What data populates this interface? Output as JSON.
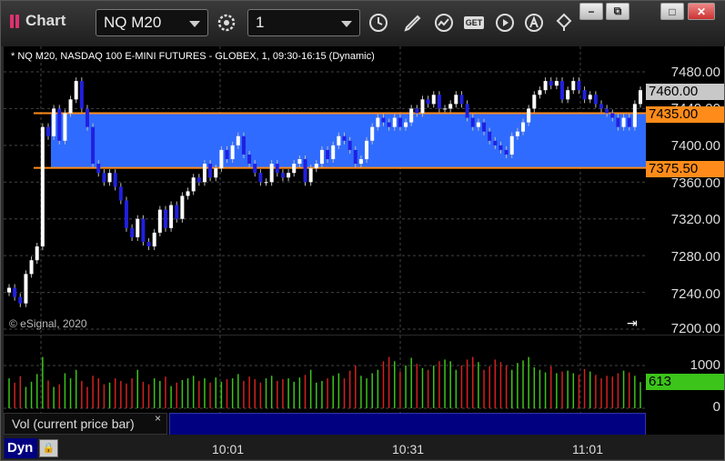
{
  "window": {
    "title": "Chart",
    "symbol": "NQ M20",
    "interval": "1",
    "controls": [
      "−",
      "⧉",
      "□",
      "✕"
    ]
  },
  "toolbar": [
    {
      "name": "settings-icon"
    },
    {
      "name": "clock-icon"
    },
    {
      "name": "pencil-icon"
    },
    {
      "name": "study-icon"
    },
    {
      "name": "get-icon",
      "label": "GET"
    },
    {
      "name": "play-icon"
    },
    {
      "name": "alert-icon"
    },
    {
      "name": "link-icon"
    }
  ],
  "chart": {
    "header": "* NQ M20, NASDAQ 100 E-MINI FUTURES - GLOBEX, 1, 09:30-16:15 (Dynamic)",
    "copyright": "© eSignal, 2020",
    "price_ticks": [
      "7480.00",
      "7440.00",
      "7400.00",
      "7360.00",
      "7320.00",
      "7280.00",
      "7240.00",
      "7200.00"
    ],
    "flags": {
      "last": "7460.00",
      "upper": "7435.00",
      "lower": "7375.50"
    },
    "zone_color": "#2f6bff",
    "line_color": "#ff8c1a"
  },
  "volume": {
    "study_label": "Vol (current price bar)",
    "close_glyph": "×",
    "ticks": [
      "1000",
      "0"
    ],
    "flag": "613"
  },
  "timebar": {
    "mode": "Dyn",
    "ticks": [
      "10:01",
      "10:31",
      "11:01"
    ]
  },
  "chart_data": {
    "type": "candlestick",
    "title": "* NQ M20, NASDAQ 100 E-MINI FUTURES - GLOBEX, 1, 09:30-16:15 (Dynamic)",
    "ylim": [
      7200,
      7500
    ],
    "zone": [
      7375.5,
      7435.0
    ],
    "last": 7460.0,
    "volume_last": 613,
    "volume_ylim": [
      0,
      1500
    ],
    "closes": [
      7245,
      7235,
      7228,
      7260,
      7275,
      7290,
      7420,
      7410,
      7440,
      7405,
      7435,
      7450,
      7470,
      7440,
      7420,
      7380,
      7370,
      7360,
      7370,
      7355,
      7340,
      7310,
      7300,
      7320,
      7295,
      7290,
      7305,
      7330,
      7310,
      7335,
      7320,
      7345,
      7350,
      7365,
      7360,
      7380,
      7365,
      7375,
      7395,
      7385,
      7400,
      7410,
      7390,
      7380,
      7370,
      7360,
      7360,
      7380,
      7370,
      7365,
      7370,
      7380,
      7385,
      7360,
      7375,
      7380,
      7395,
      7385,
      7400,
      7410,
      7405,
      7395,
      7380,
      7385,
      7405,
      7420,
      7430,
      7425,
      7420,
      7430,
      7420,
      7425,
      7440,
      7435,
      7450,
      7445,
      7455,
      7440,
      7440,
      7445,
      7455,
      7445,
      7430,
      7420,
      7425,
      7415,
      7405,
      7400,
      7395,
      7390,
      7410,
      7415,
      7425,
      7440,
      7455,
      7460,
      7470,
      7465,
      7470,
      7450,
      7460,
      7470,
      7460,
      7450,
      7455,
      7445,
      7440,
      7435,
      7430,
      7420,
      7430,
      7420,
      7445,
      7460
    ],
    "volumes": [
      700,
      600,
      750,
      500,
      620,
      800,
      1200,
      650,
      500,
      560,
      820,
      700,
      900,
      640,
      500,
      760,
      700,
      560,
      600,
      700,
      640,
      580,
      700,
      900,
      620,
      560,
      700,
      640,
      740,
      520,
      600,
      660,
      700,
      760,
      640,
      700,
      600,
      720,
      620,
      680,
      700,
      800,
      640,
      740,
      680,
      600,
      700,
      760,
      640,
      680,
      700,
      620,
      720,
      780,
      900,
      600,
      640,
      700,
      760,
      820,
      700,
      880,
      1000,
      760,
      700,
      820,
      900,
      1100,
      1200,
      1100,
      860,
      1000,
      1180,
      1040,
      940,
      900,
      1000,
      1100,
      1140,
      1100,
      900,
      1000,
      1140,
      1200,
      1080,
      900,
      980,
      1140,
      1080,
      1000,
      900,
      1060,
      1120,
      1200,
      960,
      900,
      840,
      980,
      820,
      860,
      880,
      820,
      780,
      920,
      860,
      780,
      700,
      760,
      740,
      820,
      880,
      840,
      760,
      613
    ]
  }
}
